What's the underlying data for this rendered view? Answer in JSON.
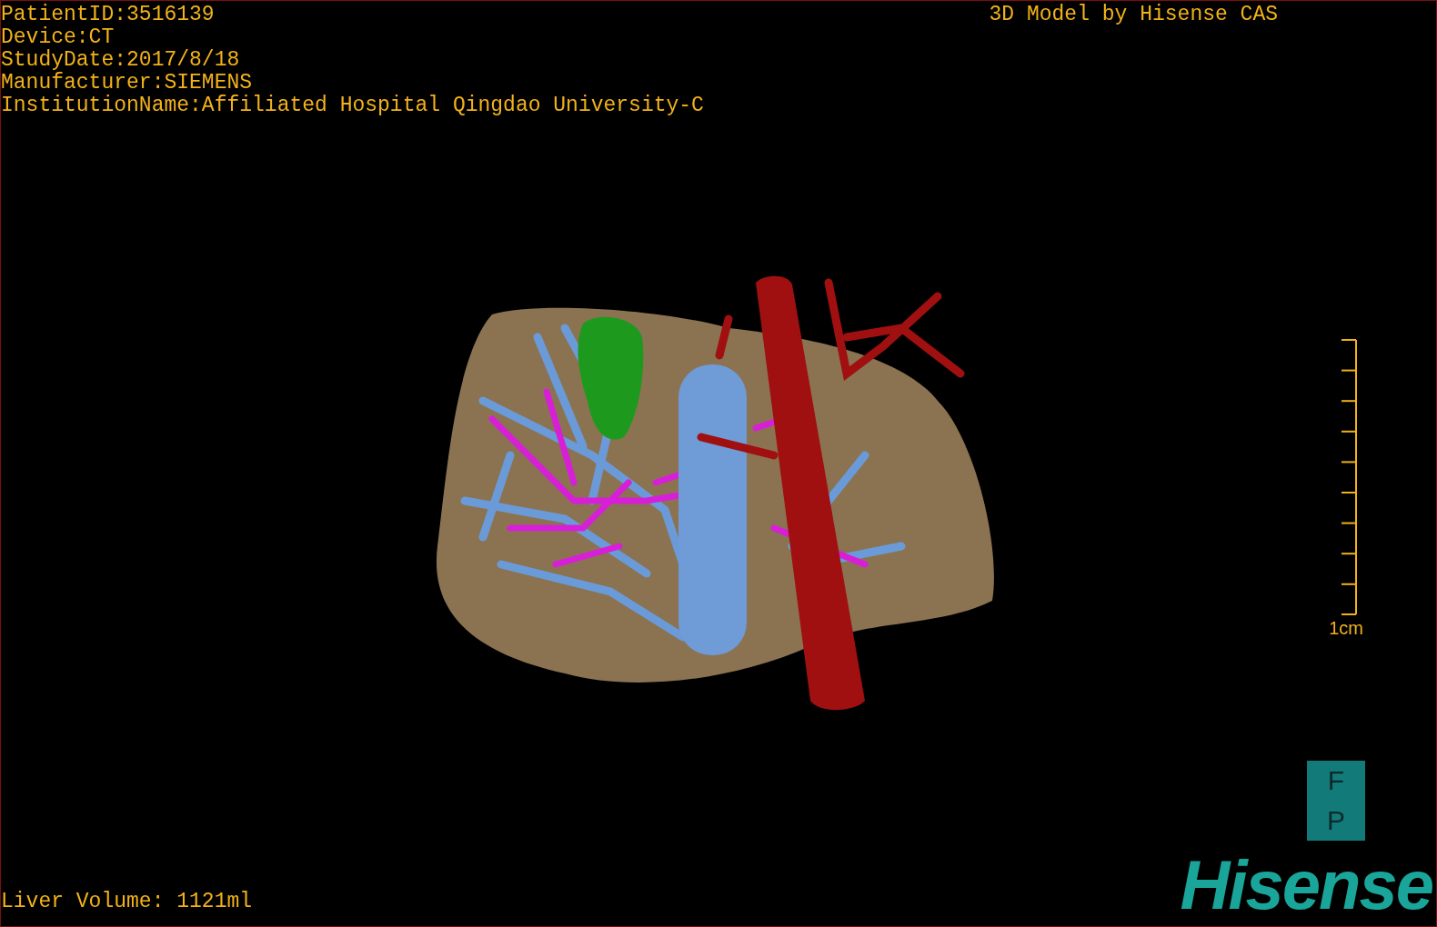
{
  "info_lines": [
    "PatientID:3516139",
    "Device:CT",
    "StudyDate:2017/8/18",
    "Manufacturer:SIEMENS",
    "InstitutionName:Affiliated Hospital Qingdao University-C"
  ],
  "header": "3D Model by Hisense CAS",
  "scale": {
    "label": "1cm"
  },
  "orientation": [
    {
      "label": "F"
    },
    {
      "label": "P"
    }
  ],
  "liver_volume": "Liver Volume: 1121ml",
  "logo": "Hisense"
}
